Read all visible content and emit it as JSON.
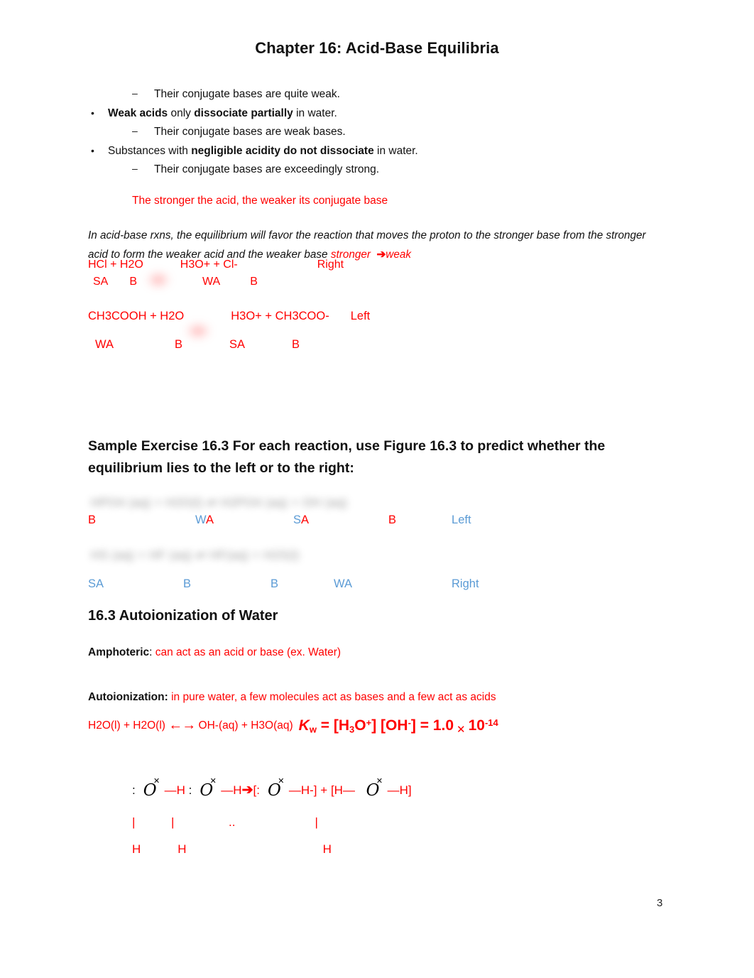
{
  "document": {
    "title": "Chapter 16:  Acid-Base Equilibria",
    "page_number": "3"
  },
  "colors": {
    "red": "#ff0000",
    "blue": "#5b9bd5",
    "black": "#111111"
  },
  "bullets": [
    {
      "level": 2,
      "marker": "–",
      "text_before": "Their conjugate bases are quite weak.",
      "bold": "",
      "text_after": ""
    },
    {
      "level": 1,
      "marker": "•",
      "text_before": "",
      "bold": "Weak acids",
      "mid": " only ",
      "bold2": "dissociate partially",
      "text_after": " in water."
    },
    {
      "level": 2,
      "marker": "–",
      "text_before": "Their conjugate bases are weak bases.",
      "bold": "",
      "text_after": ""
    },
    {
      "level": 1,
      "marker": "•",
      "text_before": "Substances with ",
      "bold": "negligible acidity do not dissociate",
      "text_after": " in water."
    },
    {
      "level": 2,
      "marker": "–",
      "text_before": "Their conjugate bases are exceedingly strong.",
      "bold": "",
      "text_after": ""
    }
  ],
  "red_note": "The stronger the acid, the weaker its conjugate base",
  "italic_paragraph": {
    "line1": "In acid-base rxns, the equilibrium will favor the reaction that moves the proton to the stronger base",
    "line2_black": "from the stronger acid to form the weaker acid and the weaker base ",
    "line2_red": "stronger",
    "line2_arrow": "➔",
    "line2_red2": "weak"
  },
  "reactions": {
    "hcl": {
      "left": "HCl + H2O",
      "right": "H3O+ + Cl-",
      "answer": "Right",
      "labels": {
        "l1": "SA",
        "l2": "B",
        "l3": "WA",
        "l4": "B"
      }
    },
    "acetic": {
      "left": "CH3COOH + H2O",
      "right": "H3O+ + CH3COO-",
      "answer": "Left",
      "labels": {
        "l1": "WA",
        "l2": "B",
        "l3": "SA",
        "l4": "B"
      }
    }
  },
  "sample_exercise": {
    "heading_line1": "Sample Exercise 16.3  For each reaction, use Figure 16.3 to predict whether the",
    "heading_line2": "equilibrium lies to the left or to the right:",
    "blurred_equation_1": "HPO4 (aq)  +  H2O(l) ⇌ H2PO4 (aq)  +  OH (aq)",
    "blurred_equation_2": "HS (aq)  +  HF (aq) ⇌  HF(aq)  +  H2S(l)",
    "row1_labels": {
      "l1": "B",
      "l2w": "W",
      "l2a": "A",
      "l3s": "S",
      "l3a": "A",
      "l4": "B",
      "answer": "Left"
    },
    "row2_labels": {
      "l1": "SA",
      "l2": "B",
      "l3": "B",
      "l4": "WA",
      "answer": "Right"
    }
  },
  "section": {
    "heading": "16.3  Autoionization of Water",
    "amphoteric_label": "Amphoteric",
    "amphoteric_sep": ": ",
    "amphoteric_text": "can act as an acid or base (ex. Water)",
    "autoionization_label": "Autoionization:",
    "autoionization_text": " in pure water, a few molecules act as bases and a few act as acids"
  },
  "kw_equation": {
    "reaction_left": "H2O(l) + H2O(l) ",
    "arrow": "←→",
    "reaction_right": " OH-(aq) + H3O(aq)",
    "k_symbol": "K",
    "k_sub": "w",
    "equals1": " = [H",
    "h3o_sub": "3",
    "h3o_rest": "O",
    "h3o_sup": "+",
    "bracket_close1": "] [OH",
    "oh_sup": "-",
    "bracket_close2": "] = 1.0",
    "times": "✕",
    "ten": "10",
    "exponent": "-14"
  },
  "lewis": {
    "row1": {
      "colon1": ":",
      "o1": "O",
      "bond1": "—H",
      "colon2": ":",
      "o2": "O",
      "bond2": "—H",
      "arrow": "➔",
      "bracket_open": "[:",
      "o3": "O",
      "bond3": "—H-]",
      "plus": "+",
      "bracket_open2": "[H—",
      "o4": "O",
      "bond4": "—H]"
    },
    "row2": {
      "bar1": "|",
      "bar2": "|",
      "dots": "..",
      "bar3": "|"
    },
    "row3": {
      "h1": "H",
      "h2": "H",
      "h3": "H"
    }
  }
}
